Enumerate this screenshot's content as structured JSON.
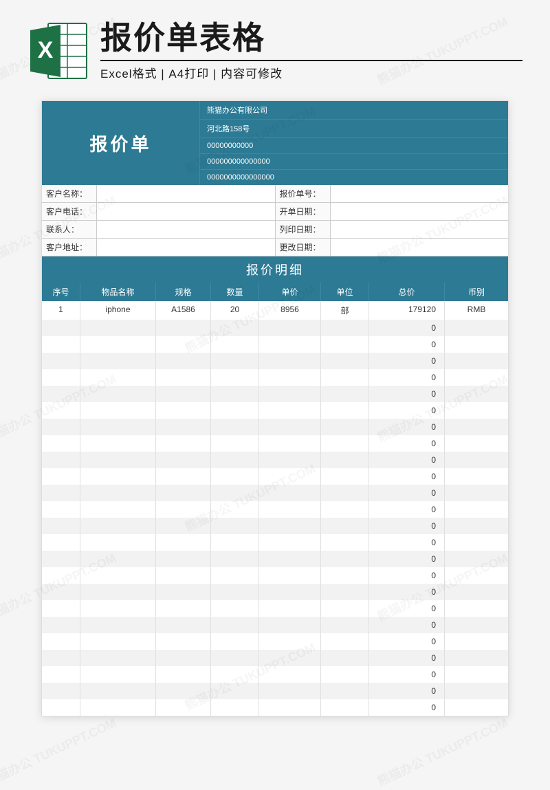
{
  "header": {
    "title": "报价单表格",
    "subtitle": "Excel格式 | A4打印 | 内容可修改",
    "icon_letter": "X"
  },
  "sheet": {
    "doc_title": "报价单",
    "company_info": [
      "熊猫办公有限公司",
      "河北路158号",
      "00000000000",
      "000000000000000",
      "0000000000000000"
    ],
    "meta_left": [
      {
        "label": "客户名称：",
        "value": ""
      },
      {
        "label": "客户电话：",
        "value": ""
      },
      {
        "label": "联系人：",
        "value": ""
      },
      {
        "label": "客户地址：",
        "value": ""
      }
    ],
    "meta_right": [
      {
        "label": "报价单号：",
        "value": ""
      },
      {
        "label": "开单日期：",
        "value": ""
      },
      {
        "label": "列印日期：",
        "value": ""
      },
      {
        "label": "更改日期：",
        "value": ""
      }
    ],
    "detail_title": "报价明细",
    "columns": [
      "序号",
      "物品名称",
      "规格",
      "数量",
      "单价",
      "单位",
      "总价",
      "币别"
    ],
    "rows": [
      {
        "no": "1",
        "name": "iphone",
        "spec": "A1586",
        "qty": "20",
        "price": "8956",
        "unit": "部",
        "total": "179120",
        "currency": "RMB"
      },
      {
        "no": "",
        "name": "",
        "spec": "",
        "qty": "",
        "price": "",
        "unit": "",
        "total": "0",
        "currency": ""
      },
      {
        "no": "",
        "name": "",
        "spec": "",
        "qty": "",
        "price": "",
        "unit": "",
        "total": "0",
        "currency": ""
      },
      {
        "no": "",
        "name": "",
        "spec": "",
        "qty": "",
        "price": "",
        "unit": "",
        "total": "0",
        "currency": ""
      },
      {
        "no": "",
        "name": "",
        "spec": "",
        "qty": "",
        "price": "",
        "unit": "",
        "total": "0",
        "currency": ""
      },
      {
        "no": "",
        "name": "",
        "spec": "",
        "qty": "",
        "price": "",
        "unit": "",
        "total": "0",
        "currency": ""
      },
      {
        "no": "",
        "name": "",
        "spec": "",
        "qty": "",
        "price": "",
        "unit": "",
        "total": "0",
        "currency": ""
      },
      {
        "no": "",
        "name": "",
        "spec": "",
        "qty": "",
        "price": "",
        "unit": "",
        "total": "0",
        "currency": ""
      },
      {
        "no": "",
        "name": "",
        "spec": "",
        "qty": "",
        "price": "",
        "unit": "",
        "total": "0",
        "currency": ""
      },
      {
        "no": "",
        "name": "",
        "spec": "",
        "qty": "",
        "price": "",
        "unit": "",
        "total": "0",
        "currency": ""
      },
      {
        "no": "",
        "name": "",
        "spec": "",
        "qty": "",
        "price": "",
        "unit": "",
        "total": "0",
        "currency": ""
      },
      {
        "no": "",
        "name": "",
        "spec": "",
        "qty": "",
        "price": "",
        "unit": "",
        "total": "0",
        "currency": ""
      },
      {
        "no": "",
        "name": "",
        "spec": "",
        "qty": "",
        "price": "",
        "unit": "",
        "total": "0",
        "currency": ""
      },
      {
        "no": "",
        "name": "",
        "spec": "",
        "qty": "",
        "price": "",
        "unit": "",
        "total": "0",
        "currency": ""
      },
      {
        "no": "",
        "name": "",
        "spec": "",
        "qty": "",
        "price": "",
        "unit": "",
        "total": "0",
        "currency": ""
      },
      {
        "no": "",
        "name": "",
        "spec": "",
        "qty": "",
        "price": "",
        "unit": "",
        "total": "0",
        "currency": ""
      },
      {
        "no": "",
        "name": "",
        "spec": "",
        "qty": "",
        "price": "",
        "unit": "",
        "total": "0",
        "currency": ""
      },
      {
        "no": "",
        "name": "",
        "spec": "",
        "qty": "",
        "price": "",
        "unit": "",
        "total": "0",
        "currency": ""
      },
      {
        "no": "",
        "name": "",
        "spec": "",
        "qty": "",
        "price": "",
        "unit": "",
        "total": "0",
        "currency": ""
      },
      {
        "no": "",
        "name": "",
        "spec": "",
        "qty": "",
        "price": "",
        "unit": "",
        "total": "0",
        "currency": ""
      },
      {
        "no": "",
        "name": "",
        "spec": "",
        "qty": "",
        "price": "",
        "unit": "",
        "total": "0",
        "currency": ""
      },
      {
        "no": "",
        "name": "",
        "spec": "",
        "qty": "",
        "price": "",
        "unit": "",
        "total": "0",
        "currency": ""
      },
      {
        "no": "",
        "name": "",
        "spec": "",
        "qty": "",
        "price": "",
        "unit": "",
        "total": "0",
        "currency": ""
      },
      {
        "no": "",
        "name": "",
        "spec": "",
        "qty": "",
        "price": "",
        "unit": "",
        "total": "0",
        "currency": ""
      },
      {
        "no": "",
        "name": "",
        "spec": "",
        "qty": "",
        "price": "",
        "unit": "",
        "total": "0",
        "currency": ""
      }
    ]
  },
  "watermark_text": "熊猫办公 TUKUPPT.COM"
}
